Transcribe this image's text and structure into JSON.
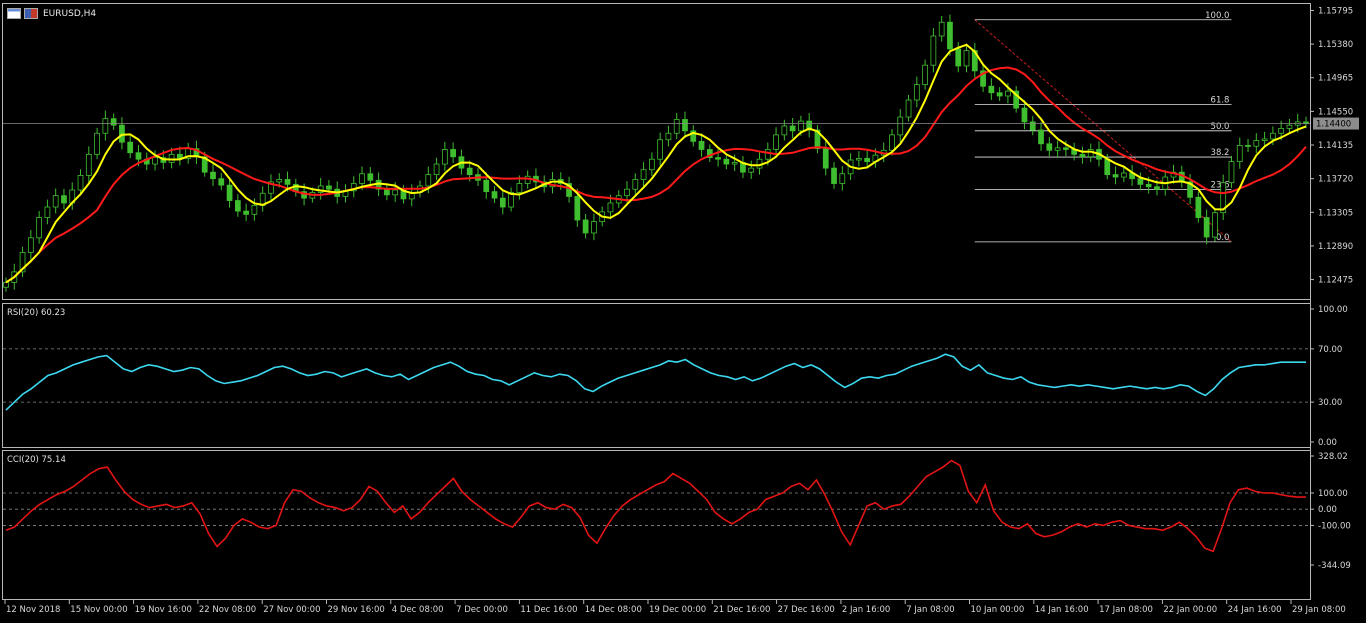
{
  "window": {
    "symbol": "EURUSD,H4"
  },
  "colors": {
    "background": "#000000",
    "candles": "#3fbf2f",
    "ma_fast": "#ffff00",
    "ma_slow": "#ff0000",
    "rsi": "#3cd8f0",
    "cci": "#e31414",
    "fibo": "#ffffff",
    "trend": "#c81e1e",
    "price_tag_bg": "#8c8c8c"
  },
  "icons": [
    "chart-window-icon",
    "flag-icon"
  ],
  "price_panel": {
    "y_ticks": [
      "1.15795",
      "1.15380",
      "1.14965",
      "1.14550",
      "1.14135",
      "1.13720",
      "1.13305",
      "1.12890",
      "1.12475"
    ],
    "current_price": "1.14400",
    "fibonacci_levels": [
      "100.0",
      "61.8",
      "50.0",
      "38.2",
      "23.6",
      "0.0"
    ]
  },
  "rsi_panel": {
    "title": "RSI(20) 60.23",
    "y_ticks": [
      "100.00",
      "70.00",
      "30.00",
      "0.00"
    ]
  },
  "cci_panel": {
    "title": "CCI(20) 75.14",
    "y_ticks": [
      "328.02",
      "100.00",
      "0.00",
      "-100.00",
      "-344.09"
    ]
  },
  "x_axis": {
    "labels": [
      "12 Nov 2018",
      "15 Nov 00:00",
      "19 Nov 16:00",
      "22 Nov 08:00",
      "27 Nov 00:00",
      "29 Nov 16:00",
      "4 Dec 08:00",
      "7 Dec 00:00",
      "11 Dec 16:00",
      "14 Dec 08:00",
      "19 Dec 00:00",
      "21 Dec 16:00",
      "27 Dec 16:00",
      "2 Jan 16:00",
      "7 Jan 08:00",
      "10 Jan 00:00",
      "14 Jan 16:00",
      "17 Jan 08:00",
      "22 Jan 00:00",
      "24 Jan 16:00",
      "29 Jan 08:00"
    ]
  },
  "chart_data": [
    {
      "type": "candlestick",
      "symbol": "EURUSD",
      "timeframe": "H4",
      "ylim": [
        1.1226,
        1.1585
      ],
      "x_ticks": [
        "12 Nov 2018",
        "15 Nov 00:00",
        "19 Nov 16:00",
        "22 Nov 08:00",
        "27 Nov 00:00",
        "29 Nov 16:00",
        "4 Dec 08:00",
        "7 Dec 00:00",
        "11 Dec 16:00",
        "14 Dec 08:00",
        "19 Dec 00:00",
        "21 Dec 16:00",
        "27 Dec 16:00",
        "2 Jan 16:00",
        "7 Jan 08:00",
        "10 Jan 00:00",
        "14 Jan 16:00",
        "17 Jan 08:00",
        "22 Jan 00:00",
        "24 Jan 16:00",
        "29 Jan 08:00"
      ],
      "close": [
        1.1244,
        1.1257,
        1.1281,
        1.1299,
        1.1324,
        1.1337,
        1.1351,
        1.1342,
        1.1358,
        1.1376,
        1.1402,
        1.1428,
        1.1446,
        1.1438,
        1.1417,
        1.1404,
        1.1396,
        1.139,
        1.1398,
        1.1392,
        1.1402,
        1.1397,
        1.1409,
        1.1399,
        1.138,
        1.1372,
        1.1364,
        1.1345,
        1.1332,
        1.1328,
        1.1339,
        1.1354,
        1.1368,
        1.1371,
        1.1365,
        1.1356,
        1.1348,
        1.1355,
        1.1363,
        1.1359,
        1.135,
        1.1357,
        1.1366,
        1.1378,
        1.137,
        1.1359,
        1.1352,
        1.1358,
        1.1347,
        1.1355,
        1.1363,
        1.1377,
        1.139,
        1.1408,
        1.1399,
        1.1385,
        1.1377,
        1.137,
        1.1356,
        1.1348,
        1.1337,
        1.1355,
        1.1366,
        1.1375,
        1.1368,
        1.1362,
        1.1371,
        1.1366,
        1.135,
        1.1321,
        1.1305,
        1.1319,
        1.1331,
        1.1342,
        1.1351,
        1.1359,
        1.1371,
        1.1383,
        1.1396,
        1.142,
        1.1428,
        1.1445,
        1.1431,
        1.1418,
        1.1408,
        1.1398,
        1.1396,
        1.139,
        1.1392,
        1.138,
        1.1385,
        1.1396,
        1.1408,
        1.1426,
        1.1437,
        1.1431,
        1.1443,
        1.1432,
        1.1409,
        1.1385,
        1.1366,
        1.1378,
        1.1395,
        1.1397,
        1.1393,
        1.1401,
        1.1407,
        1.1426,
        1.1448,
        1.1469,
        1.1488,
        1.1512,
        1.1548,
        1.1565,
        1.1532,
        1.1511,
        1.153,
        1.1505,
        1.1486,
        1.1478,
        1.1474,
        1.148,
        1.1459,
        1.1442,
        1.1432,
        1.1415,
        1.1407,
        1.141,
        1.1408,
        1.1402,
        1.1399,
        1.1408,
        1.1396,
        1.1377,
        1.1374,
        1.1379,
        1.1372,
        1.1365,
        1.1362,
        1.1359,
        1.1374,
        1.138,
        1.1368,
        1.1349,
        1.1324,
        1.13,
        1.133,
        1.1367,
        1.1393,
        1.1413,
        1.1412,
        1.1419,
        1.1421,
        1.1428,
        1.1434,
        1.1438,
        1.1442,
        1.144
      ],
      "indicators": [
        {
          "name": "Moving Average (fast)",
          "color": "yellow"
        },
        {
          "name": "Moving Average (slow)",
          "color": "red"
        }
      ],
      "fibonacci": {
        "levels": [
          "100.0",
          "61.8",
          "50.0",
          "38.2",
          "23.6",
          "0.0"
        ],
        "high": 1.1568,
        "low": 1.1294
      },
      "current_price": 1.144
    },
    {
      "type": "line",
      "name": "RSI(20)",
      "last_value": 60.23,
      "ylim": [
        0,
        100
      ],
      "levels": [
        70,
        30
      ],
      "values": [
        24,
        30,
        36,
        40,
        45,
        50,
        52,
        55,
        58,
        60,
        62,
        64,
        65,
        60,
        55,
        53,
        56,
        58,
        57,
        55,
        53,
        54,
        56,
        55,
        50,
        46,
        44,
        45,
        46,
        48,
        50,
        53,
        56,
        57,
        55,
        52,
        50,
        51,
        53,
        52,
        49,
        51,
        53,
        55,
        52,
        50,
        49,
        51,
        47,
        50,
        53,
        56,
        58,
        60,
        57,
        53,
        51,
        50,
        47,
        46,
        43,
        46,
        49,
        52,
        50,
        49,
        51,
        50,
        46,
        40,
        38,
        42,
        45,
        48,
        50,
        52,
        54,
        56,
        58,
        61,
        60,
        62,
        58,
        55,
        52,
        50,
        49,
        47,
        49,
        46,
        48,
        51,
        54,
        57,
        59,
        56,
        58,
        55,
        50,
        45,
        41,
        44,
        48,
        49,
        48,
        50,
        51,
        54,
        57,
        59,
        61,
        63,
        66,
        64,
        57,
        54,
        58,
        52,
        50,
        48,
        47,
        49,
        45,
        43,
        42,
        41,
        42,
        43,
        42,
        43,
        42,
        41,
        40,
        41,
        42,
        41,
        40,
        41,
        40,
        41,
        43,
        42,
        38,
        35,
        40,
        47,
        52,
        56,
        57,
        58,
        58,
        59,
        60,
        60,
        60,
        60
      ]
    },
    {
      "type": "line",
      "name": "CCI(20)",
      "last_value": 75.14,
      "ylim": [
        -344.09,
        328.02
      ],
      "levels": [
        100,
        0,
        -100
      ],
      "values": [
        -130,
        -110,
        -60,
        -10,
        30,
        60,
        90,
        110,
        140,
        180,
        220,
        250,
        260,
        180,
        110,
        60,
        30,
        10,
        20,
        30,
        10,
        20,
        40,
        -30,
        -150,
        -230,
        -180,
        -100,
        -60,
        -80,
        -110,
        -120,
        -100,
        40,
        120,
        110,
        70,
        40,
        20,
        10,
        -10,
        10,
        60,
        140,
        110,
        40,
        -20,
        20,
        -60,
        -20,
        40,
        90,
        140,
        190,
        110,
        60,
        20,
        -20,
        -60,
        -90,
        -110,
        -50,
        20,
        40,
        10,
        0,
        30,
        10,
        -50,
        -160,
        -210,
        -120,
        -40,
        20,
        60,
        90,
        120,
        150,
        170,
        220,
        190,
        160,
        110,
        60,
        -20,
        -60,
        -90,
        -60,
        -20,
        0,
        60,
        80,
        100,
        140,
        160,
        120,
        180,
        90,
        -20,
        -140,
        -220,
        -100,
        20,
        40,
        0,
        20,
        30,
        80,
        140,
        200,
        230,
        260,
        300,
        270,
        110,
        40,
        150,
        -10,
        -80,
        -110,
        -120,
        -90,
        -150,
        -170,
        -160,
        -140,
        -110,
        -90,
        -110,
        -90,
        -100,
        -80,
        -70,
        -100,
        -110,
        -120,
        -120,
        -130,
        -110,
        -80,
        -120,
        -170,
        -240,
        -260,
        -120,
        40,
        120,
        130,
        110,
        100,
        100,
        90,
        80,
        75,
        75
      ]
    }
  ]
}
